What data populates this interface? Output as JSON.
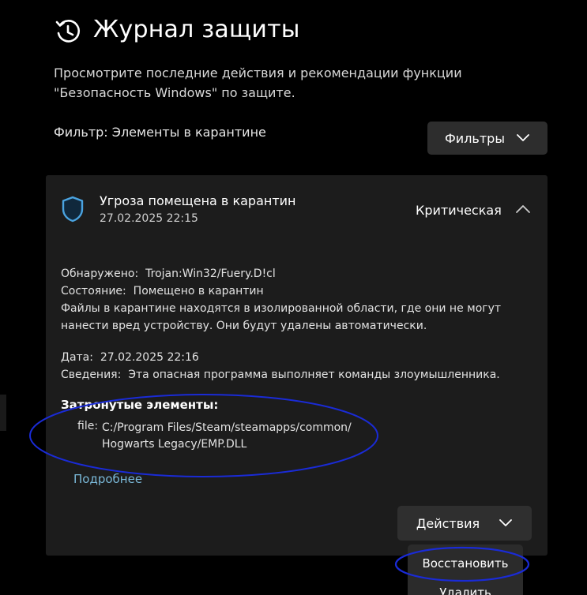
{
  "header": {
    "title": "Журнал защиты",
    "description": "Просмотрите последние действия и рекомендации функции \"Безопасность Windows\" по защите."
  },
  "filter": {
    "label": "Фильтр: Элементы в карантине",
    "button_label": "Фильтры"
  },
  "threat": {
    "title": "Угроза помещена в карантин",
    "date": "27.02.2025 22:15",
    "severity": "Критическая",
    "detected_label": "Обнаружено:",
    "detected_value": "Trojan:Win32/Fuery.D!cl",
    "status_label": "Состояние:",
    "status_value": "Помещено в карантин",
    "quarantine_note_1": "Файлы в карантине находятся в изолированной области, где они не могут",
    "quarantine_note_2": "нанести вред устройству. Они будут удалены автоматически.",
    "date_label": "Дата:",
    "date_value": "27.02.2025 22:16",
    "info_label": "Сведения:",
    "info_value": "Эта опасная программа выполняет команды злоумышленника.",
    "affected_title": "Затронутые элементы:",
    "file_label": "file:",
    "file_path_1": "C:/Program Files/Steam/steamapps/common/",
    "file_path_2": "Hogwarts Legacy/EMP.DLL",
    "more_link": "Подробнее",
    "actions_label": "Действия"
  },
  "actions_menu": {
    "restore": "Восстановить",
    "delete": "Удалить"
  },
  "colors": {
    "background": "#000000",
    "card": "#1c1c1c",
    "button": "#2d2d2d",
    "link": "#7ab8d8",
    "shield_accent": "#4aa3e0",
    "annotation_circle": "#1a2bd6"
  },
  "icons": {
    "header": "history-clock-icon",
    "threat": "shield-icon",
    "expand": "chevron-up-icon",
    "dropdown": "chevron-down-icon"
  }
}
